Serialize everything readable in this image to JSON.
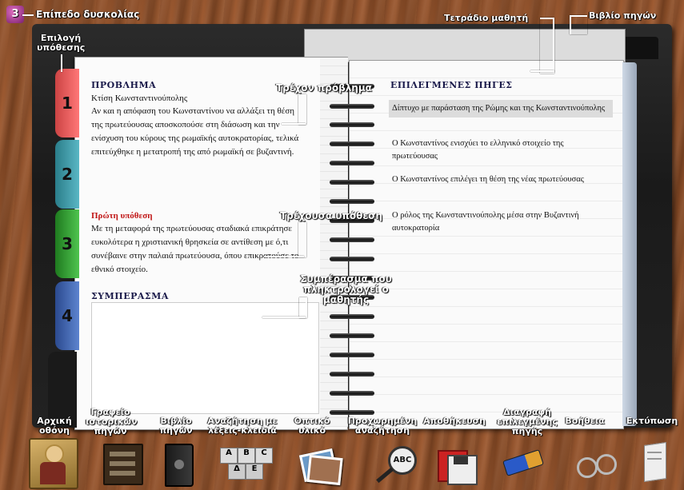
{
  "top": {
    "level_badge": "3",
    "level_label": "Επίπεδο δυσκολίας",
    "notebook_label": "Τετράδιο μαθητή",
    "sourcebook_label": "Βιβλίο πηγών",
    "hypothesis_select_label": "Επιλογή υπόθεσης"
  },
  "tabs": [
    "1",
    "2",
    "3",
    "4"
  ],
  "problem": {
    "heading": "ΠΡΟΒΛΗΜΑ",
    "title": "Κτίση Κωνσταντινούπολης",
    "text": "Αν και η απόφαση του Κωνσταντίνου να αλλάξει τη θέση της πρωτεύουσας αποσκοπούσε στη διάσωση και την ενίσχυση του κύρους της ρωμαϊκής αυτοκρατορίας, τελικά επιτεύχθηκε η μετατροπή της από ρωμαϊκή σε βυζαντινή.",
    "callout": "Τρέχον πρόβλημα"
  },
  "hypothesis": {
    "heading": "Πρώτη υπόθεση",
    "text": "Με τη μεταφορά της πρωτεύουσας σταδιακά επικράτησε ευκολότερα η χριστιανική θρησκεία σε αντίθεση με ό,τι συνέβαινε στην παλαιά πρωτεύουσα, όπου επικρατούσε το εθνικό στοιχείο.",
    "callout": "Τρέχουσα υπόθεση"
  },
  "conclusion": {
    "heading": "ΣΥΜΠΕΡΑΣΜΑ",
    "value": "",
    "callout": "Συμπέρασμα που πληκτρολογεί ο μαθητής"
  },
  "sources": {
    "heading": "ΕΠΙΛΕΓΜΕΝΕΣ ΠΗΓΕΣ",
    "items": [
      "Δίπτυχο με παράσταση της Ρώμης και της Κωνσταντινούπολης",
      "Ο Κωνσταντίνος ενισχύει το ελληνικό στοιχείο της πρωτεύουσας",
      "Ο Κωνσταντίνος επιλέγει τη θέση της νέας πρωτεύουσας",
      "Ο ρόλος της Κωνσταντινούπολης μέσα στην Βυζαντινή αυτοκρατορία"
    ]
  },
  "toolbar": [
    {
      "label": "Αρχική οθόνη",
      "icon": "byzantine-icon-image"
    },
    {
      "label": "Γραφείο ιστορικών πηγών",
      "icon": "desk-icon"
    },
    {
      "label": "Βιβλίο πηγών",
      "icon": "book-icon"
    },
    {
      "label": "Αναζήτηση με λέξεις-κλειδιά",
      "icon": "keyword-blocks-icon"
    },
    {
      "label": "Οπτικό υλικό",
      "icon": "photos-icon"
    },
    {
      "label": "Προχωρημένη αναζήτηση",
      "icon": "magnifier-icon"
    },
    {
      "label": "Αποθήκευση",
      "icon": "save-disk-icon"
    },
    {
      "label": "Διαγραφή επιλεγμένης πηγής",
      "icon": "eraser-icon"
    },
    {
      "label": "Βοήθεια",
      "icon": "glasses-icon"
    },
    {
      "label": "Εκτύπωση",
      "icon": "print-page-icon"
    }
  ]
}
